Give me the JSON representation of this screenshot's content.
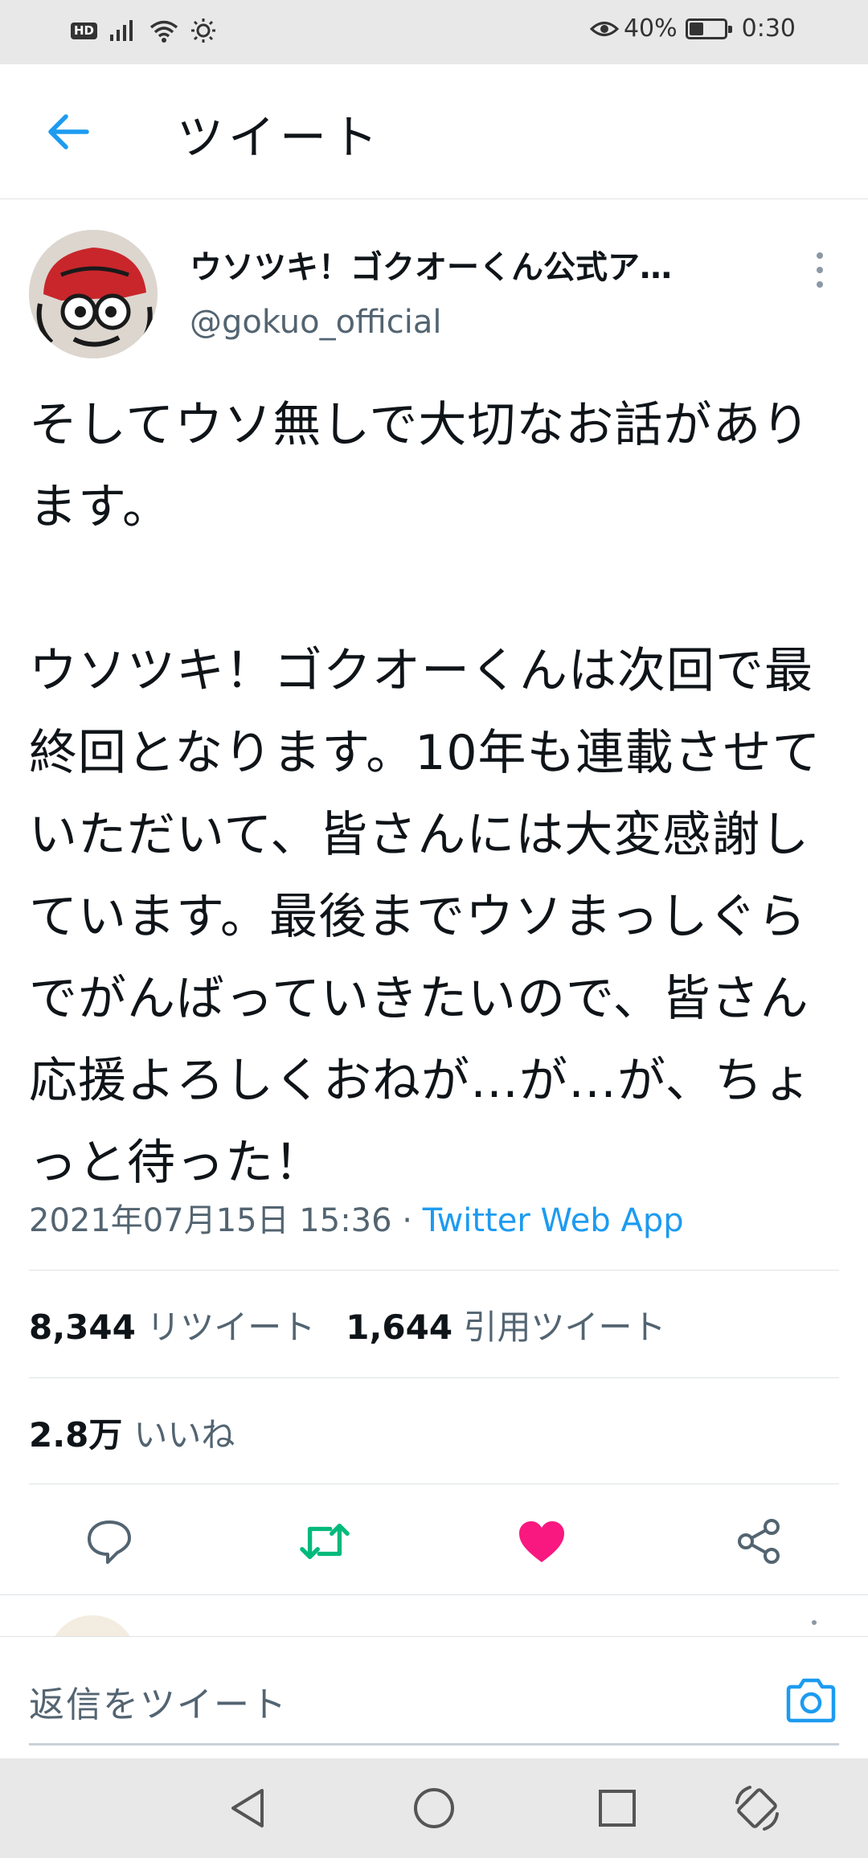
{
  "status_bar": {
    "hd": "HD",
    "battery_percent": "40%",
    "battery_level": 0.4,
    "time": "0:30"
  },
  "header": {
    "title": "ツイート",
    "back_icon": "arrow-left-icon"
  },
  "tweet": {
    "author_name": "ウソツキ！ゴクオーくん公式ア…",
    "author_handle": "@gokuo_official",
    "text": "そしてウソ無しで大切なお話があります。\n\nウソツキ！ゴクオーくんは次回で最終回となります。10年も連載させていただいて、皆さんには大変感謝しています。最後までウソまっしぐらでがんばっていきたいので、皆さん応援よろしくおねが…が…が、ちょっと待った！",
    "timestamp": "2021年07月15日 15:36",
    "separator": " · ",
    "source": "Twitter Web App"
  },
  "stats": {
    "retweets_count": "8,344",
    "retweets_label": "リツイート",
    "quotes_count": "1,644",
    "quotes_label": "引用ツイート",
    "likes_count": "2.8万",
    "likes_label": "いいね"
  },
  "actions": {
    "reply_icon": "comment-icon",
    "retweet_icon": "retweet-icon",
    "like_icon": "heart-icon",
    "share_icon": "share-icon"
  },
  "reply": {
    "placeholder": "返信をツイート",
    "camera_icon": "camera-icon"
  },
  "colors": {
    "accent": "#1d9bf0",
    "retweet_active": "#00ba7c",
    "like_active": "#f91880",
    "secondary_text": "#536471"
  }
}
